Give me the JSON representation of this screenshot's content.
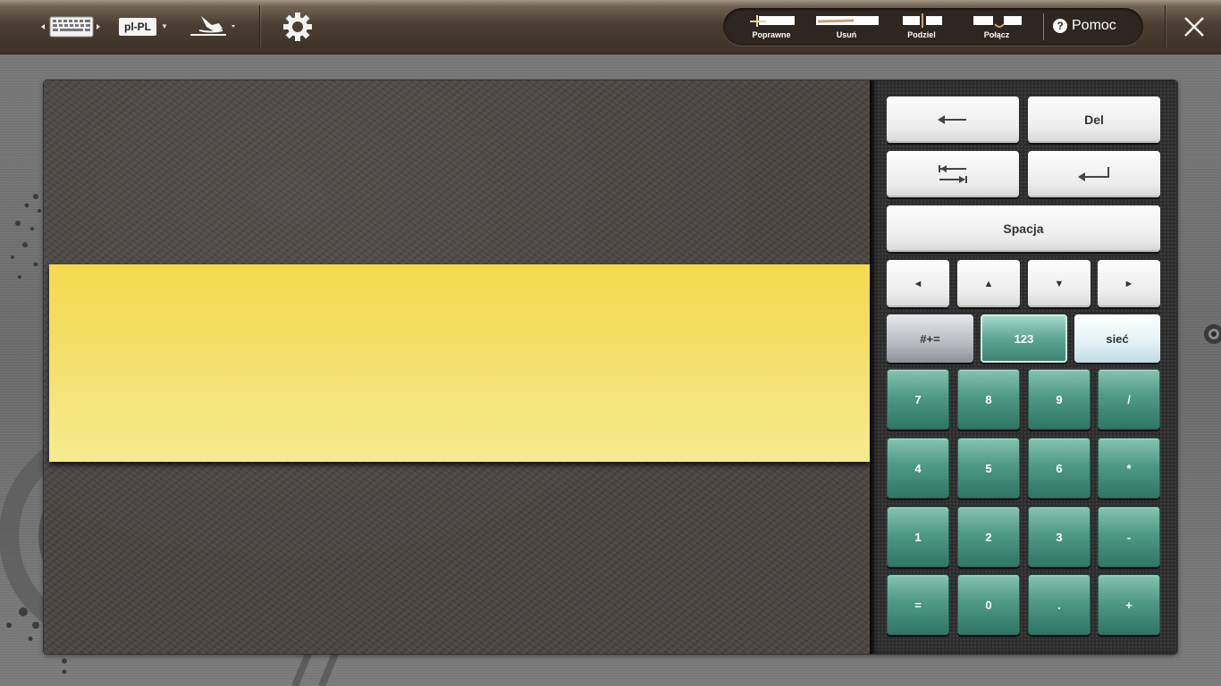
{
  "toolbar": {
    "language": "pl-PL",
    "gestures": [
      {
        "id": "correct",
        "label": "Poprawne"
      },
      {
        "id": "delete",
        "label": "Usuń"
      },
      {
        "id": "split",
        "label": "Podziel"
      },
      {
        "id": "join",
        "label": "Połącz"
      }
    ],
    "help_label": "Pomoc",
    "help_icon_glyph": "?"
  },
  "keypad": {
    "delete_label": "Del",
    "space_label": "Spacja",
    "mode_symbols": "#+=",
    "mode_numbers": "123",
    "mode_web": "sieć",
    "numpad": [
      [
        "7",
        "8",
        "9",
        "/"
      ],
      [
        "4",
        "5",
        "6",
        "*"
      ],
      [
        "1",
        "2",
        "3",
        "-"
      ],
      [
        "=",
        "0",
        ".",
        "+"
      ]
    ],
    "arrow_glyphs": {
      "left": "◄",
      "up": "▲",
      "down": "▼",
      "right": "►"
    }
  },
  "colors": {
    "writing_strip": "#f4da4e",
    "numpad_key": "#4f9a85",
    "toolbar": "#3b3228"
  }
}
